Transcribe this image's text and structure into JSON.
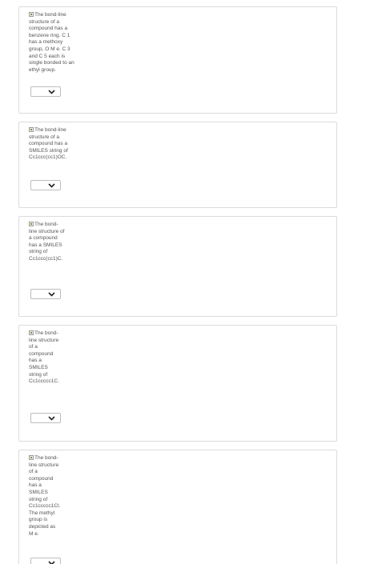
{
  "questions": [
    {
      "alt_text": "The bond-line structure of a compound has a benzene ring. C 1 has a methoxy group, O M e. C 3 and C 5 each is single bonded to an ethyl group.",
      "select": {
        "selected_value": "",
        "icon": "chevron-down-icon"
      }
    },
    {
      "alt_text": "The bond-line structure of a compound has a SMILES string of Cc1ccc(cc1)OC.",
      "select": {
        "selected_value": "",
        "icon": "chevron-down-icon"
      }
    },
    {
      "alt_text": "The bond-line structure of a compound has a SMILES string of Cc1ccc(cc1)C.",
      "select": {
        "selected_value": "",
        "icon": "chevron-down-icon"
      }
    },
    {
      "alt_text": "The bond-line structure of a compound has a SMILES string of Cc1ccccc1C.",
      "select": {
        "selected_value": "",
        "icon": "chevron-down-icon"
      }
    },
    {
      "alt_text": "The bond-line structure of a compound has a SMILES string of Cc1ccccc1Cl. The methyl group is depicted as M e.",
      "select": {
        "selected_value": "",
        "icon": "chevron-down-icon"
      }
    }
  ],
  "colors": {
    "card_border": "#dcdcdc",
    "text": "#555555",
    "chevron": "#222222"
  }
}
